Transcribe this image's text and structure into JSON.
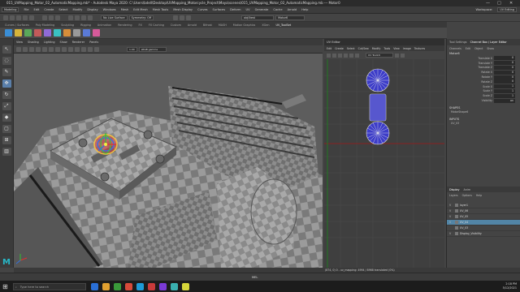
{
  "window": {
    "title": "015_UVMapping_Motor_02_AutomaticMapping.mb* - Autodesk Maya 2020: C:\\Users\\bdell\\Desktop\\UVMapping_Motorcycle_Project\\Maya\\scenes\\015_UVMapping_Motor_02_AutomaticMapping.mb  ---  Motor0",
    "controls": [
      "—",
      "□",
      "✕"
    ]
  },
  "menubar": {
    "mode": "Modeling",
    "items": [
      "File",
      "Edit",
      "Create",
      "Select",
      "Modify",
      "Display",
      "Windows",
      "Mesh",
      "Edit Mesh",
      "Mesh Tools",
      "Mesh Display",
      "Curves",
      "Surfaces",
      "Deform",
      "UV",
      "Generate",
      "Cache",
      "Arnold",
      "Help"
    ],
    "workspace_label": "Workspace:",
    "workspace": "UV Editing"
  },
  "statusline": {
    "live_surface": "No Live Surface",
    "symmetry": "Symmetry: Off",
    "object_field": "obj0test",
    "search": "Motor6"
  },
  "shelf": {
    "tabs": [
      "Curves / Surfaces",
      "Poly Modeling",
      "Sculpting",
      "Rigging",
      "Animation",
      "Rendering",
      "FX",
      "FX Caching",
      "Custom",
      "Arnold",
      "Bifrost",
      "MASH",
      "Motion Graphics",
      "XGen",
      "UV_ToolSet"
    ],
    "active_tab": "UV_ToolSet",
    "icon_colors": [
      "#3a8ed6",
      "#d6b43a",
      "#5aa85a",
      "#c25a5a",
      "#8f6ad6",
      "#3ac2c2",
      "#d68e3a",
      "#9a9a9a",
      "#5a7ad6",
      "#d65a9a"
    ]
  },
  "toolbox": {
    "tools": [
      "select-tool",
      "lasso-tool",
      "paint-select-tool",
      "move-tool",
      "rotate-tool",
      "scale-tool",
      "last-tool",
      "layout-single",
      "layout-four",
      "layout-side"
    ],
    "glyphs": [
      "↖",
      "◌",
      "✎",
      "✥",
      "↻",
      "⤢",
      "◆",
      "▢",
      "⊞",
      "▥"
    ]
  },
  "viewport": {
    "menu": [
      "View",
      "Shading",
      "Lighting",
      "Show",
      "Renderer",
      "Panels"
    ],
    "gamma_value": "1.00",
    "colorspace": "sRGB gamma",
    "gizmo_label": "Universal manipulator"
  },
  "uv_editor": {
    "title": "UV Editor",
    "menu": [
      "Edit",
      "Create",
      "Select",
      "Cut/Sew",
      "Modify",
      "Tools",
      "View",
      "Image",
      "Textures"
    ],
    "texture_field": "UV Toolkit",
    "status": "(874, 0,..., 0/170 - uv_mapping: 4994 / 8968 - 0 uvs - 0 uvs)"
  },
  "channel_box": {
    "panel_tabs": [
      "Tool Settings",
      "Channel Box / Layer Editor"
    ],
    "active_tab": "Channel Box / Layer Editor",
    "sub_menu": [
      "Channels",
      "Edit",
      "Object",
      "Show"
    ],
    "object_name": "Motor6",
    "attributes": [
      {
        "label": "Translate X",
        "value": "0"
      },
      {
        "label": "Translate Y",
        "value": "0"
      },
      {
        "label": "Translate Z",
        "value": "0"
      },
      {
        "label": "Rotate X",
        "value": "0"
      },
      {
        "label": "Rotate Y",
        "value": "0"
      },
      {
        "label": "Rotate Z",
        "value": "0"
      },
      {
        "label": "Scale X",
        "value": "1"
      },
      {
        "label": "Scale Y",
        "value": "1"
      },
      {
        "label": "Scale Z",
        "value": "1"
      },
      {
        "label": "Visibility",
        "value": "on"
      }
    ],
    "shapes_head": "SHAPES",
    "shapes": [
      "MotorShape6"
    ],
    "inputs_head": "INPUTS",
    "inputs": [
      "UV_03"
    ]
  },
  "layers": {
    "tabs": [
      "Display",
      "Anim"
    ],
    "active": "Display",
    "sub": [
      "Layers",
      "Options",
      "Help"
    ],
    "rows": [
      {
        "vis": "V",
        "name": "layer1",
        "selected": false
      },
      {
        "vis": "V",
        "name": "UV_06",
        "selected": false
      },
      {
        "vis": "V",
        "name": "UV_05",
        "selected": false
      },
      {
        "vis": "V",
        "name": "UV_04",
        "selected": true
      },
      {
        "vis": "",
        "name": "UV_03",
        "selected": false
      },
      {
        "vis": "V",
        "name": "Display_Visibility",
        "selected": false
      }
    ]
  },
  "cmdline": {
    "lang": "MEL"
  },
  "helpline": {
    "text": "(874, 0) 0 - uv_mapping: 4994 / 8968 translated (0%)"
  },
  "taskbar": {
    "search_placeholder": "Type here to search",
    "icon_colors": [
      "#2a6fd6",
      "#e0a030",
      "#3a9a3a",
      "#d64a3a",
      "#1e9ad6",
      "#c83a3a",
      "#7a3ad6",
      "#3ab0b0",
      "#d6d63a"
    ],
    "time": "2:18 PM",
    "date": "5/12/2021"
  }
}
